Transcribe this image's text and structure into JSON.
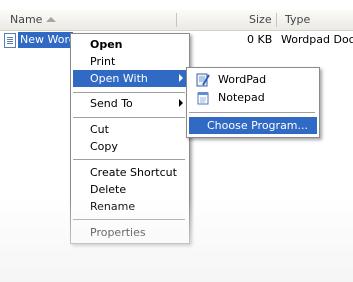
{
  "header": {
    "name_label": "Name",
    "size_label": "Size",
    "type_label": "Type"
  },
  "file": {
    "name": "New WordPad Document",
    "size": "0 KB",
    "type": "Wordpad Document"
  },
  "context_menu": {
    "open": "Open",
    "print": "Print",
    "open_with": "Open With",
    "send_to": "Send To",
    "cut": "Cut",
    "copy": "Copy",
    "create_shortcut": "Create Shortcut",
    "delete": "Delete",
    "rename": "Rename",
    "properties": "Properties"
  },
  "submenu": {
    "wordpad": "WordPad",
    "notepad": "Notepad",
    "choose_program": "Choose Program..."
  },
  "colors": {
    "highlight": "#316ac5"
  },
  "icons": {
    "file": "wordpad-document-icon",
    "sort": "sort-ascending-icon",
    "wordpad": "wordpad-icon",
    "notepad": "notepad-icon",
    "submenu": "chevron-right-icon"
  }
}
